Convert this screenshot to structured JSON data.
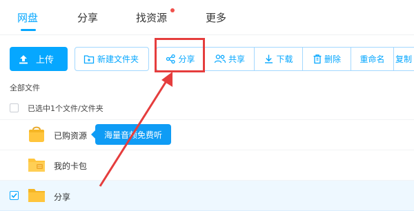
{
  "tabs": [
    {
      "label": "网盘",
      "active": true
    },
    {
      "label": "分享",
      "active": false
    },
    {
      "label": "找资源",
      "active": false,
      "badge_dot": true
    },
    {
      "label": "更多",
      "active": false
    }
  ],
  "toolbar": {
    "upload_label": "上传",
    "new_folder_label": "新建文件夹",
    "actions": [
      {
        "label": "分享",
        "icon": "share-icon"
      },
      {
        "label": "共享",
        "icon": "users-icon"
      },
      {
        "label": "下载",
        "icon": "download-icon"
      },
      {
        "label": "删除",
        "icon": "trash-icon"
      },
      {
        "label": "重命名",
        "icon": ""
      },
      {
        "label": "复制",
        "icon": ""
      }
    ]
  },
  "breadcrumb": "全部文件",
  "selection_text": "已选中1个文件/文件夹",
  "files": [
    {
      "name": "已购资源",
      "icon": "bag-folder-icon",
      "checked": false
    },
    {
      "name": "我的卡包",
      "icon": "card-folder-icon",
      "checked": false
    },
    {
      "name": "分享",
      "icon": "folder-icon",
      "checked": true
    }
  ],
  "tooltip": "海量音频免费听",
  "colors": {
    "accent": "#06a7ff",
    "highlight": "#e53d3d",
    "folder": "#ffc53d",
    "selected_bg": "#eef8ff"
  }
}
